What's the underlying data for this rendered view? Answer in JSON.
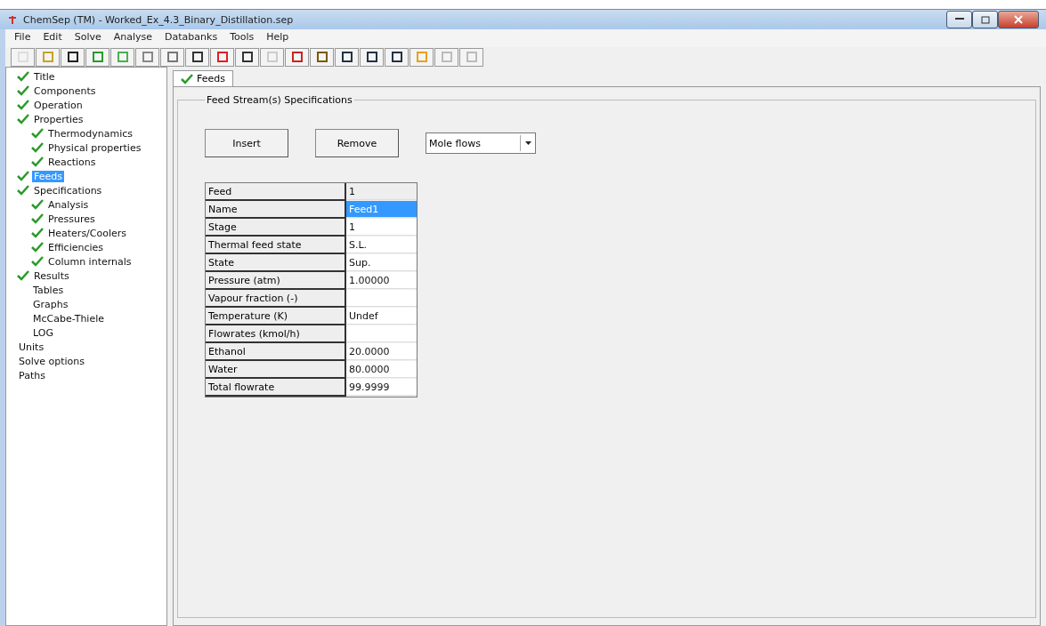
{
  "window": {
    "title": "ChemSep (TM) - Worked_Ex_4.3_Binary_Distillation.sep"
  },
  "menu": [
    "File",
    "Edit",
    "Solve",
    "Analyse",
    "Databanks",
    "Tools",
    "Help"
  ],
  "tree": [
    {
      "label": "Title",
      "checked": true,
      "selected": false
    },
    {
      "label": "Components",
      "checked": true,
      "selected": false
    },
    {
      "label": "Operation",
      "checked": true,
      "selected": false
    },
    {
      "label": "Properties",
      "checked": true,
      "selected": false,
      "children": [
        {
          "label": "Thermodynamics",
          "checked": true,
          "selected": false
        },
        {
          "label": "Physical properties",
          "checked": true,
          "selected": false
        },
        {
          "label": "Reactions",
          "checked": true,
          "selected": false
        }
      ]
    },
    {
      "label": "Feeds",
      "checked": true,
      "selected": true
    },
    {
      "label": "Specifications",
      "checked": true,
      "selected": false,
      "children": [
        {
          "label": "Analysis",
          "checked": true,
          "selected": false
        },
        {
          "label": "Pressures",
          "checked": true,
          "selected": false
        },
        {
          "label": "Heaters/Coolers",
          "checked": true,
          "selected": false
        },
        {
          "label": "Efficiencies",
          "checked": true,
          "selected": false
        },
        {
          "label": "Column internals",
          "checked": true,
          "selected": false
        }
      ]
    },
    {
      "label": "Results",
      "checked": true,
      "selected": false,
      "children": [
        {
          "label": "Tables",
          "checked": false,
          "selected": false
        },
        {
          "label": "Graphs",
          "checked": false,
          "selected": false
        },
        {
          "label": "McCabe-Thiele",
          "checked": false,
          "selected": false
        },
        {
          "label": "LOG",
          "checked": false,
          "selected": false
        }
      ]
    },
    {
      "label": "Units",
      "checked": false,
      "selected": false
    },
    {
      "label": "Solve options",
      "checked": false,
      "selected": false
    },
    {
      "label": "Paths",
      "checked": false,
      "selected": false
    }
  ],
  "tab": {
    "label": "Feeds",
    "checked": true
  },
  "group": {
    "title": "Feed Stream(s) Specifications",
    "buttons": [
      "Insert",
      "Remove"
    ],
    "dropdown": "Mole flows"
  },
  "table": {
    "columns": [
      "Feed",
      "1"
    ],
    "rows": [
      {
        "label": "Name",
        "value": "Feed1",
        "selected": true
      },
      {
        "label": "Stage",
        "value": "1",
        "selected": false
      },
      {
        "label": "Thermal feed state",
        "value": "S.L.",
        "selected": false
      },
      {
        "label": "State",
        "value": "Sup.",
        "selected": false
      },
      {
        "label": "Pressure (atm)",
        "value": "1.00000",
        "selected": false
      },
      {
        "label": "Vapour fraction (-)",
        "value": "",
        "selected": false
      },
      {
        "label": "Temperature (K)",
        "value": "Undef",
        "selected": false
      },
      {
        "label": "Flowrates (kmol/h)",
        "value": "",
        "selected": false
      },
      {
        "label": "Ethanol",
        "value": "20.0000",
        "selected": false
      },
      {
        "label": "Water",
        "value": "80.0000",
        "selected": false
      },
      {
        "label": "Total flowrate",
        "value": "99.9999",
        "selected": false
      }
    ]
  }
}
